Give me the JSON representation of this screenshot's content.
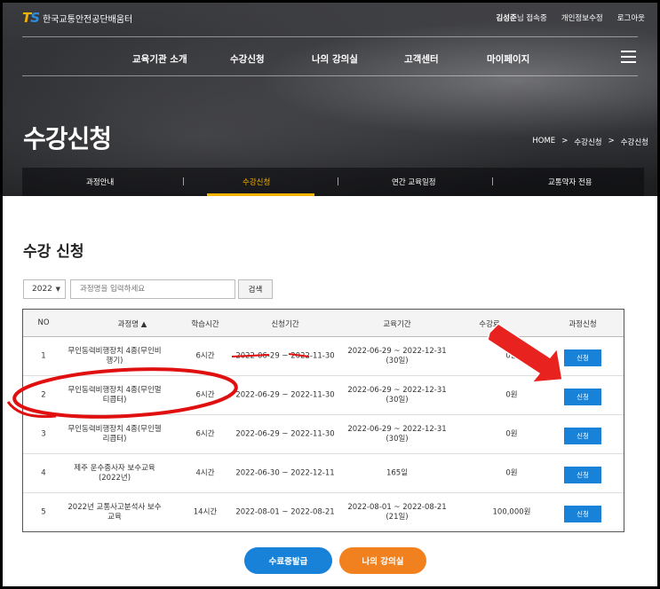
{
  "header": {
    "logo_mark_t": "T",
    "logo_mark_s": "S",
    "logo_text": "한국교통안전공단배움터",
    "user_name": "김성준",
    "user_suffix": "님 접속중",
    "privacy_link": "개인정보수정",
    "logout_link": "로그아웃"
  },
  "nav": {
    "items": [
      {
        "label": "교육기관 소개"
      },
      {
        "label": "수강신청"
      },
      {
        "label": "나의 강의실"
      },
      {
        "label": "고객센터"
      },
      {
        "label": "마이페이지"
      }
    ]
  },
  "hero": {
    "title": "수강신청",
    "breadcrumb": [
      "HOME",
      "수강신청",
      "수강신청"
    ],
    "breadcrumb_sep": ">"
  },
  "subnav": {
    "items": [
      {
        "label": "과정안내"
      },
      {
        "label": "수강신청"
      },
      {
        "label": "연간 교육일정"
      },
      {
        "label": "교통약자 전용"
      }
    ],
    "active_index": 1
  },
  "main": {
    "section_title": "수강 신청",
    "year_value": "2022",
    "search_placeholder": "과정명을 입력하세요",
    "search_button": "검색"
  },
  "table": {
    "columns": [
      "NO",
      "과정명 ▲",
      "학습시간",
      "신청기간",
      "교육기간",
      "수강료",
      "과정신청"
    ],
    "rows": [
      {
        "no": "1",
        "name": "무인동력비행장치 4종(무인비행기)",
        "hours": "6시간",
        "apply_period": "2022-06-29 ~ 2022-11-30",
        "edu_period": "2022-06-29 ~ 2022-12-31",
        "edu_days": "(30일)",
        "fee": "0원",
        "action": "신청"
      },
      {
        "no": "2",
        "name": "무인동력비행장치 4종(무인멀티콥터)",
        "hours": "6시간",
        "apply_period": "2022-06-29 ~ 2022-11-30",
        "edu_period": "2022-06-29 ~ 2022-12-31",
        "edu_days": "(30일)",
        "fee": "0원",
        "action": "신청"
      },
      {
        "no": "3",
        "name": "무인동력비행장치 4종(무인헬리콥터)",
        "hours": "6시간",
        "apply_period": "2022-06-29 ~ 2022-11-30",
        "edu_period": "2022-06-29 ~ 2022-12-31",
        "edu_days": "(30일)",
        "fee": "0원",
        "action": "신청"
      },
      {
        "no": "4",
        "name": "제주 운수종사자 보수교육(2022년)",
        "hours": "4시간",
        "apply_period": "2022-06-30 ~ 2022-12-11",
        "edu_period": "165일",
        "edu_days": "",
        "fee": "0원",
        "action": "신청"
      },
      {
        "no": "5",
        "name": "2022년 교통사고분석사 보수교육",
        "hours": "14시간",
        "apply_period": "2022-08-01 ~ 2022-08-21",
        "edu_period": "2022-08-01 ~ 2022-08-21",
        "edu_days": "(21일)",
        "fee": "100,000원",
        "action": "신청"
      }
    ]
  },
  "footer_buttons": {
    "certificate": "수료증발급",
    "my_classroom": "나의 강의실"
  },
  "colors": {
    "accent_yellow": "#f2b300",
    "apply_blue": "#1782d8",
    "orange": "#f1811e",
    "annotation_red": "#e01010"
  }
}
